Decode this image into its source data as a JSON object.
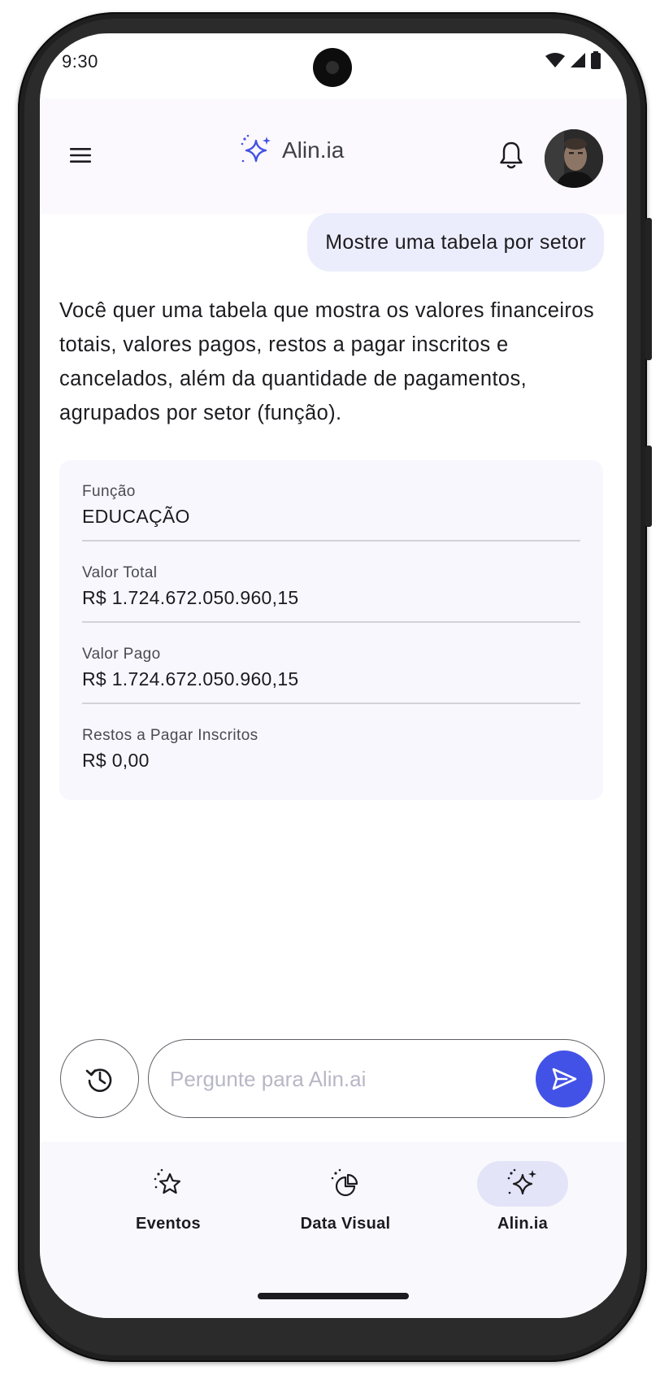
{
  "status_bar": {
    "time": "9:30"
  },
  "header": {
    "title": "Alin.ia",
    "icons": [
      "menu-icon",
      "sparkle-icon",
      "bell-icon",
      "avatar"
    ]
  },
  "chat": {
    "user_message": "Mostre uma tabela por setor",
    "assistant_message": "Você quer uma tabela que mostra os valores financeiros totais, valores pagos, restos a pagar inscritos e cancelados, além da quantidade de pagamentos, agrupados por setor (função).",
    "table": [
      {
        "label": "Função",
        "value": "EDUCAÇÃO"
      },
      {
        "label": "Valor Total",
        "value": "R$ 1.724.672.050.960,15"
      },
      {
        "label": "Valor Pago",
        "value": "R$ 1.724.672.050.960,15"
      },
      {
        "label": "Restos a Pagar Inscritos",
        "value": "R$ 0,00"
      }
    ]
  },
  "composer": {
    "placeholder": "Pergunte para Alin.ai",
    "value": ""
  },
  "nav": {
    "items": [
      {
        "label": "Eventos",
        "icon": "star-sparkle-icon",
        "active": false
      },
      {
        "label": "Data Visual",
        "icon": "pie-chart-icon",
        "active": false
      },
      {
        "label": "Alin.ia",
        "icon": "sparkle-icon",
        "active": true
      }
    ]
  },
  "colors": {
    "accent": "#4352e6",
    "bubble": "#ecedfc",
    "card": "#f8f7fd",
    "nav_active": "#e3e4f8"
  }
}
